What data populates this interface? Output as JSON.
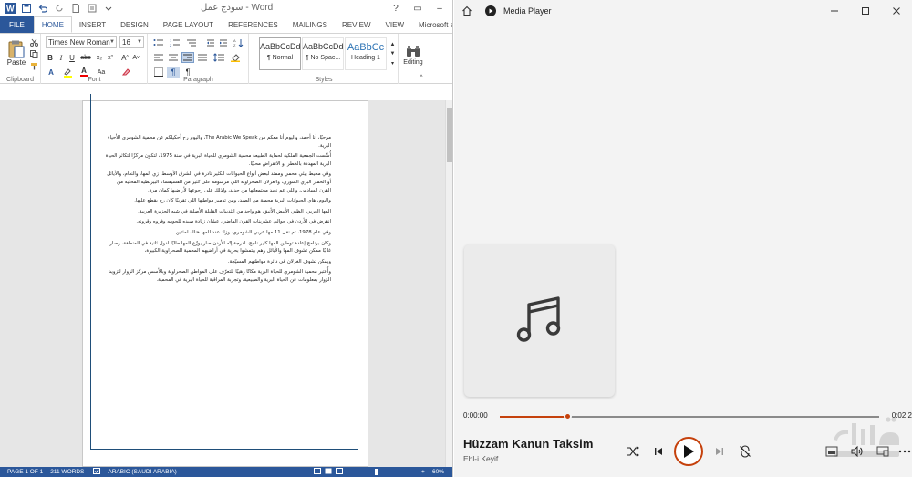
{
  "word": {
    "window_title": "سودج عمل - Word",
    "tabs": [
      {
        "label": "FILE"
      },
      {
        "label": "HOME"
      },
      {
        "label": "INSERT"
      },
      {
        "label": "DESIGN"
      },
      {
        "label": "PAGE LAYOUT"
      },
      {
        "label": "REFERENCES"
      },
      {
        "label": "MAILINGS"
      },
      {
        "label": "REVIEW"
      },
      {
        "label": "VIEW"
      },
      {
        "label": "Microsoft acc..."
      }
    ],
    "ribbon": {
      "clipboard": {
        "paste_label": "Paste",
        "group_label": "Clipboard"
      },
      "font": {
        "font_name": "Times New Roman",
        "font_size": "16",
        "group_label": "Font"
      },
      "paragraph": {
        "group_label": "Paragraph"
      },
      "styles": {
        "items": [
          {
            "sample": "AaBbCcDd",
            "name": "¶ Normal"
          },
          {
            "sample": "AaBbCcDd",
            "name": "¶ No Spac..."
          },
          {
            "sample": "AaBbCc",
            "name": "Heading 1"
          }
        ],
        "group_label": "Styles"
      },
      "editing": {
        "label": "Editing"
      }
    },
    "document": {
      "paragraphs": [
        "مرحبًا، أنا أحمد، واليوم أنا معكم من The Arabic We Speak، واليوم رح أحكيلكم عن محمية الشومري للأحياء البرية.",
        "أُسِّست الجمعية الملكية لحماية الطبيعة محمية الشومري للحياة البرية في سنة 1975، لتكون مركزًا لتكاثر الحياة البرية المهددة بالخطر أو الانقراض محليًا.",
        "وفي محيط بيئي محمي وممتد لبعض أنواع الحيوانات الكثير نادرة في الشرق الأوسط، زي المها، والنعام، والأيائل أو الحمار البري السوري، والغزلان الصحراوية اللي مرسومة على كثير من الفسيفساء البيزنطية المحلية من القرن السادس، واللي عم نعيد مجتمعاتها من جديد، ولذلك على رجوعها لأراضيها كمان مرة.",
        "واليوم، هاي الحيوانات البرية محمية من الصيد، ومن تدمير مواطنها اللي تقريبًا كان رح يقطع عليها.",
        "المها العربي، الظبي الأبيض الأنيق، هو واحد من الثدييات القليلة الأصلية في شبه الجزيرة العربية.",
        "انقرض في الأردن في حوالي عشرينات القرن الماضي، عشان زيادة صيده للحومه وفروه وقرونه.",
        "وفي عام 1978، تم نقل 11 مها عربي للشومري، وزاد عدد المها هناك لمئتين.",
        "وكان برنامج إعادة توطين المها كثير ناجح، لدرجة إنّه الأردن صار يوزّع المها حاليًا لدول ثانية في المنطقة، وصار غالبًا ممكن تشوف المها والأيائل وهم بيتمشوا بحرية في أراضيهم المحمية الصحراوية الكبيرة،",
        "ويمكن تشوف الغزلان في دائرة مواطنهم المسيّجة.",
        "وأُعتبر محمية الشومري للحياة البرية مكانًا رهيبًا للتعرّف على المواطن الصحراوية وبالأسس مركز الزوار لتزويد الزوار بمعلومات عن الحياة البرية والطبيعية، وتجربة المراقبة للحياة البرية في المحمية."
      ]
    },
    "status": {
      "page": "PAGE 1 OF 1",
      "words": "211 WORDS",
      "language": "ARABIC (SAUDI ARABIA)",
      "zoom": "60%",
      "zoom_level": 0.6
    }
  },
  "media_player": {
    "app_name": "Media Player",
    "time_elapsed": "0:00:00",
    "time_total": "0:02:2",
    "progress": 0.18,
    "track_title": "Hüzzam Kanun Taksim",
    "track_artist": "Ehl-i Keyif",
    "accent_color": "#c5410c",
    "controls": [
      "shuffle-icon",
      "previous-icon",
      "play-icon",
      "next-icon",
      "repeat-off-icon",
      "miniplayer-icon",
      "volume-icon",
      "cast-icon",
      "more-icon"
    ],
    "watermark": "مستقل mostaql.com"
  }
}
